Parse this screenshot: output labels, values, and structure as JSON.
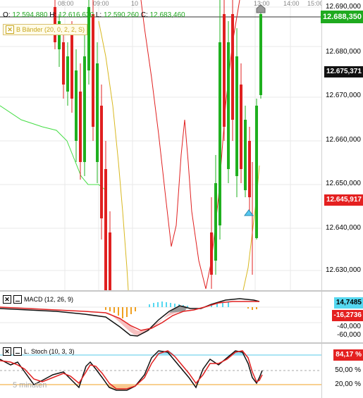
{
  "top_times": [
    "08:00",
    "09:00",
    "10",
    "13:00",
    "14:00",
    "15:00"
  ],
  "ohlc": {
    "o_label": "O:",
    "o": "12.594,880",
    "h_label": "H:",
    "h": "12.616,630",
    "l_label": "L:",
    "l": "12.590,260",
    "c_label": "C:",
    "c": "12.683,460"
  },
  "bb_label": "B Bänder (20, 0, 2, 2, S)",
  "price_axis": {
    "ticks": [
      "12.690,000",
      "12.680,000",
      "12.670,000",
      "12.660,000",
      "12.650,000",
      "12.640,000",
      "12.630,000"
    ],
    "badge_top": "12.688,350",
    "badge_mid": "12.675,371",
    "badge_red": "12.645,917"
  },
  "macd": {
    "label": "MACD (12, 26, 9)",
    "badge_cyan": "14,7485",
    "badge_red": "-16,2736",
    "ticks": [
      "-40,000",
      "-60,000"
    ]
  },
  "stoch": {
    "label": "L. Stoch (10, 3, 3)",
    "badge": "84,17 %",
    "ticks": [
      "50,00 %",
      "20,00 %"
    ],
    "watermark": "5 minuten"
  },
  "colors": {
    "green": "#1fb01f",
    "red": "#e02020",
    "cyan": "#55d8f0",
    "orange": "#f0a020",
    "badge_green": "#1faa1f",
    "badge_dark": "#111111",
    "badge_red": "#e42020"
  }
}
